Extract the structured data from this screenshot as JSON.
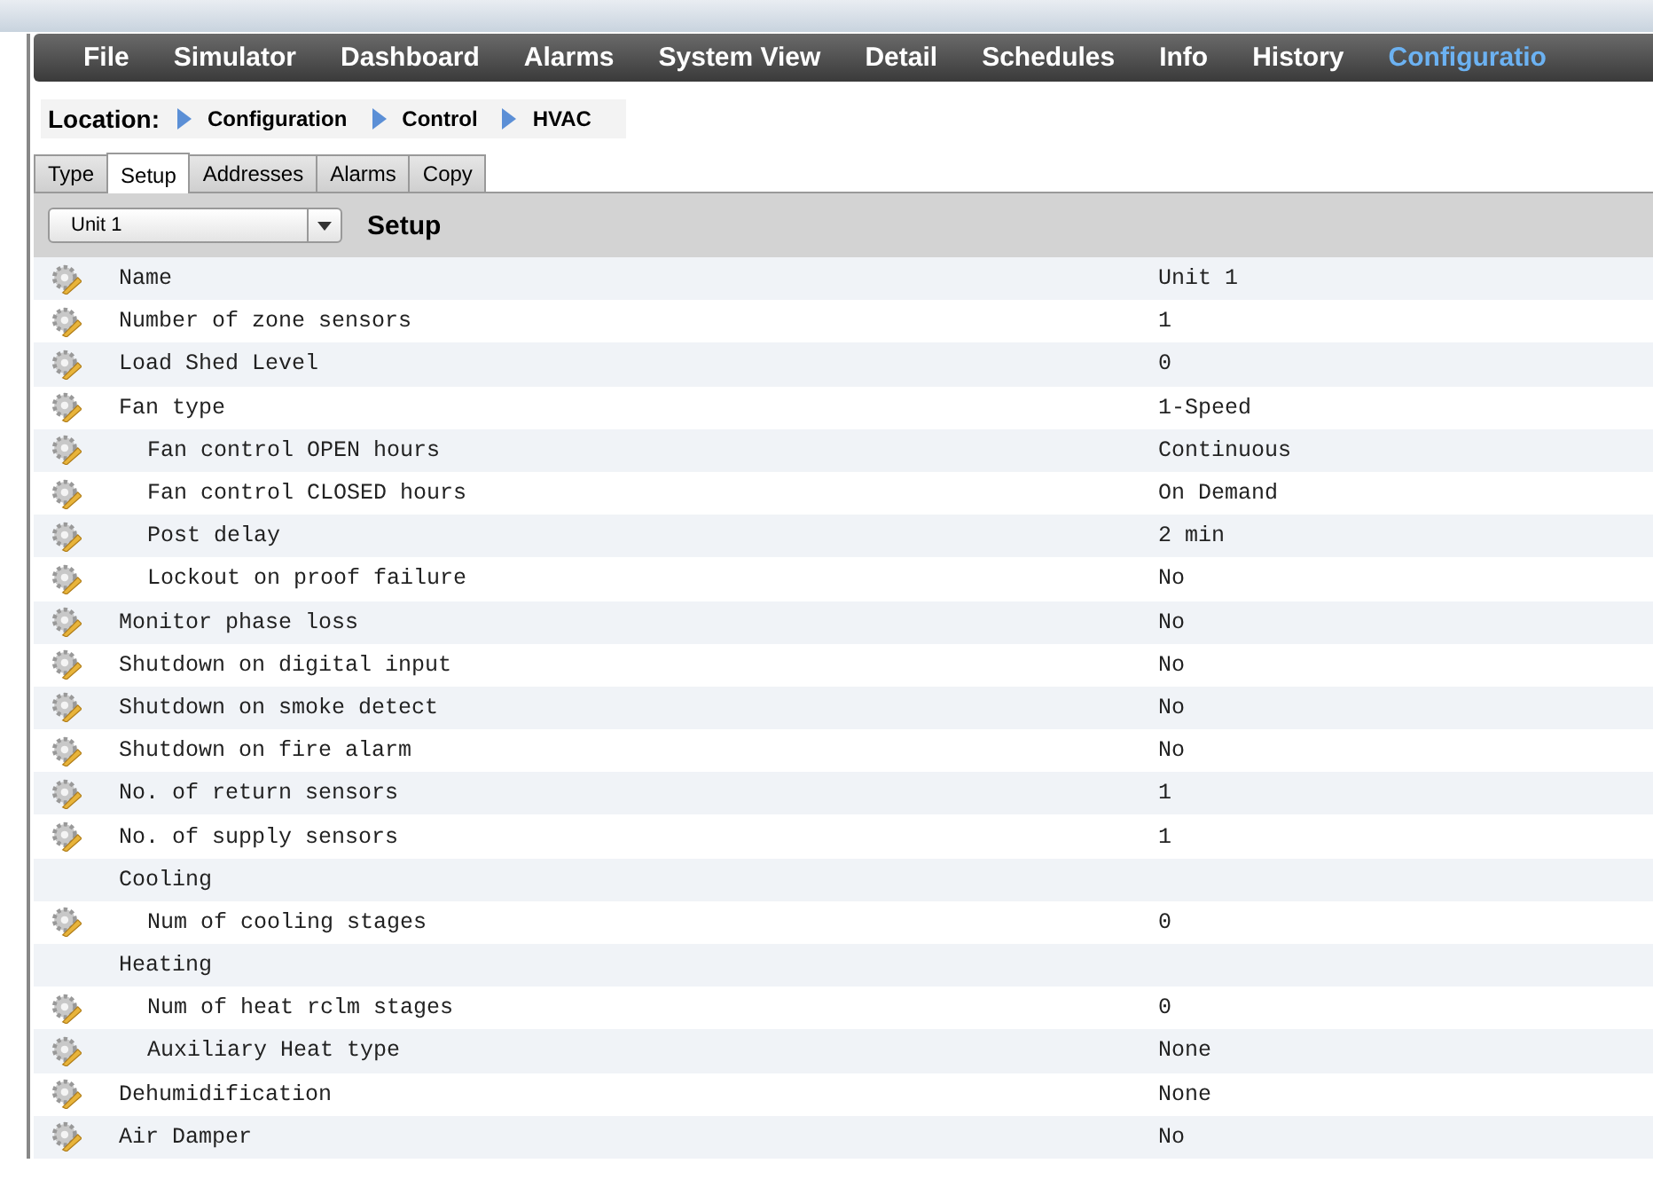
{
  "menu": [
    {
      "label": "File",
      "selected": false
    },
    {
      "label": "Simulator",
      "selected": false
    },
    {
      "label": "Dashboard",
      "selected": false
    },
    {
      "label": "Alarms",
      "selected": false
    },
    {
      "label": "System View",
      "selected": false
    },
    {
      "label": "Detail",
      "selected": false
    },
    {
      "label": "Schedules",
      "selected": false
    },
    {
      "label": "Info",
      "selected": false
    },
    {
      "label": "History",
      "selected": false
    },
    {
      "label": "Configuratio",
      "selected": true
    }
  ],
  "location": {
    "label": "Location:",
    "path": [
      "Configuration",
      "Control",
      "HVAC"
    ]
  },
  "tabs": [
    {
      "label": "Type",
      "selected": false
    },
    {
      "label": "Setup",
      "selected": true
    },
    {
      "label": "Addresses",
      "selected": false
    },
    {
      "label": "Alarms",
      "selected": false
    },
    {
      "label": "Copy",
      "selected": false
    }
  ],
  "toolbar": {
    "unit_select": "Unit 1",
    "title": "Setup"
  },
  "settings": [
    {
      "kind": "setting",
      "name": "Name",
      "value": "Unit 1"
    },
    {
      "kind": "setting",
      "name": "Number of zone sensors",
      "value": "1"
    },
    {
      "kind": "setting",
      "name": "Load Shed Level",
      "value": "0"
    },
    {
      "kind": "setting",
      "name": "Fan type",
      "value": "1-Speed",
      "children": [
        {
          "kind": "setting",
          "name": "Fan control OPEN hours",
          "value": "Continuous"
        },
        {
          "kind": "setting",
          "name": "Fan control CLOSED hours",
          "value": "On Demand"
        },
        {
          "kind": "setting",
          "name": "Post delay",
          "value": "2 min"
        },
        {
          "kind": "setting",
          "name": "Lockout on proof failure",
          "value": "No"
        }
      ]
    },
    {
      "kind": "setting",
      "name": "Monitor phase loss",
      "value": "No"
    },
    {
      "kind": "setting",
      "name": "Shutdown on digital input",
      "value": "No"
    },
    {
      "kind": "setting",
      "name": "Shutdown on smoke detect",
      "value": "No"
    },
    {
      "kind": "setting",
      "name": "Shutdown on fire alarm",
      "value": "No"
    },
    {
      "kind": "setting",
      "name": "No. of return sensors",
      "value": "1"
    },
    {
      "kind": "setting",
      "name": "No. of supply sensors",
      "value": "1"
    },
    {
      "kind": "heading",
      "name": "Cooling",
      "children": [
        {
          "kind": "setting",
          "name": "Num of cooling stages",
          "value": "0"
        }
      ]
    },
    {
      "kind": "heading",
      "name": "Heating",
      "children": [
        {
          "kind": "setting",
          "name": "Num of heat rclm stages",
          "value": "0"
        },
        {
          "kind": "setting",
          "name": "Auxiliary Heat type",
          "value": "None"
        }
      ]
    },
    {
      "kind": "setting",
      "name": "Dehumidification",
      "value": "None"
    },
    {
      "kind": "setting",
      "name": "Air Damper",
      "value": "No"
    }
  ]
}
